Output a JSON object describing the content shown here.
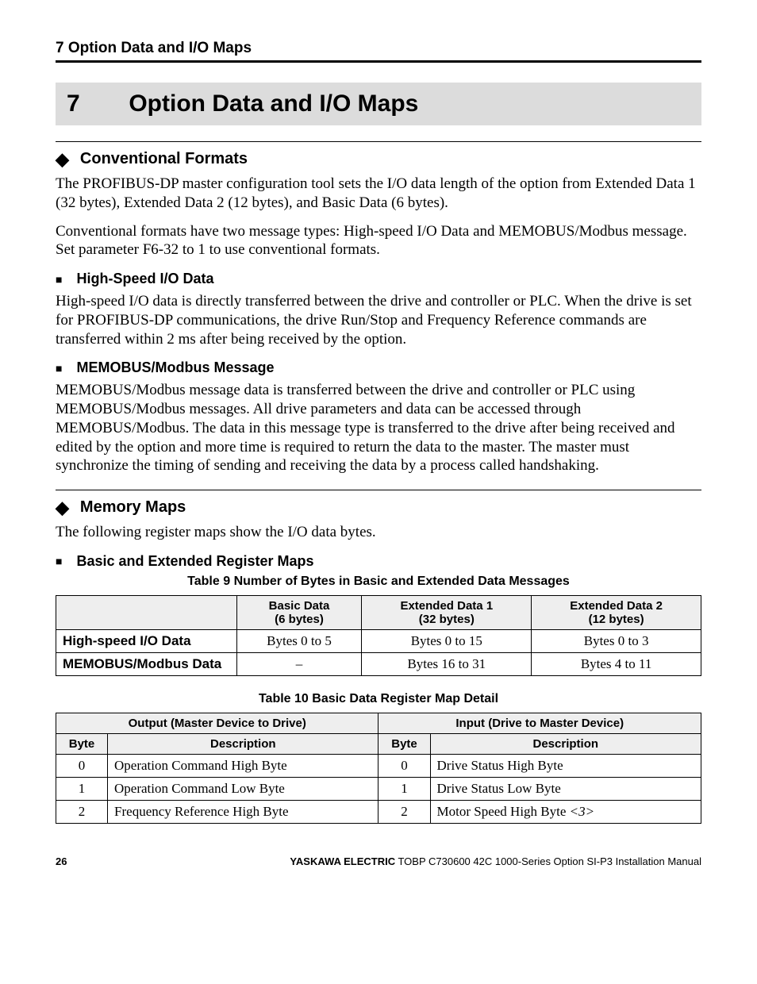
{
  "running_header": "7  Option Data and I/O Maps",
  "chapter": {
    "num": "7",
    "title": "Option Data and I/O Maps"
  },
  "sec1": {
    "title": "Conventional Formats",
    "p1": "The PROFIBUS-DP master configuration tool sets the I/O data length of the option from Extended Data 1 (32 bytes), Extended Data 2 (12 bytes), and Basic Data (6 bytes).",
    "p2": "Conventional formats have two message types: High-speed I/O Data and MEMOBUS/Modbus message. Set parameter F6-32 to 1 to use conventional formats.",
    "sub1": {
      "title": "High-Speed I/O Data",
      "p": "High-speed I/O data is directly transferred between the drive and controller or PLC. When the drive is set for PROFIBUS-DP communications, the drive Run/Stop and Frequency Reference commands are transferred within 2 ms after being received by the option."
    },
    "sub2": {
      "title": "MEMOBUS/Modbus Message",
      "p": "MEMOBUS/Modbus message data is transferred between the drive and controller or PLC using MEMOBUS/Modbus messages. All drive parameters and data can be accessed through MEMOBUS/Modbus. The data in this message type is transferred to the drive after being received and edited by the option and more time is required to return the data to the master. The master must synchronize the timing of sending and receiving the data by a process called handshaking."
    }
  },
  "sec2": {
    "title": "Memory Maps",
    "p1": "The following register maps show the I/O data bytes.",
    "sub1": {
      "title": "Basic and Extended Register Maps"
    }
  },
  "table9": {
    "caption": "Table 9  Number of Bytes in Basic and Extended Data Messages",
    "headers": {
      "blank": "",
      "c1a": "Basic Data",
      "c1b": "(6 bytes)",
      "c2a": "Extended Data 1",
      "c2b": "(32 bytes)",
      "c3a": "Extended Data 2",
      "c3b": "(12 bytes)"
    },
    "rows": [
      {
        "label": "High-speed I/O Data",
        "c1": "Bytes 0 to 5",
        "c2": "Bytes 0 to 15",
        "c3": "Bytes 0 to 3"
      },
      {
        "label": "MEMOBUS/Modbus Data",
        "c1": "–",
        "c2": "Bytes 16 to 31",
        "c3": "Bytes 4 to 11"
      }
    ]
  },
  "table10": {
    "caption": "Table 10  Basic Data Register Map Detail",
    "group_headers": {
      "out": "Output (Master Device to Drive)",
      "in": "Input (Drive to Master Device)"
    },
    "col_headers": {
      "byte": "Byte",
      "desc": "Description"
    },
    "rows": [
      {
        "ob": "0",
        "od": "Operation Command High Byte",
        "ib": "0",
        "id": "Drive Status High Byte"
      },
      {
        "ob": "1",
        "od": "Operation Command Low Byte",
        "ib": "1",
        "id": "Drive Status Low Byte"
      },
      {
        "ob": "2",
        "od": "Frequency Reference High Byte",
        "ib": "2",
        "id": "Motor Speed High Byte ",
        "note": "<3>"
      }
    ]
  },
  "footer": {
    "page": "26",
    "brand": "YASKAWA ELECTRIC",
    "doc": " TOBP C730600 42C 1000-Series Option SI-P3 Installation Manual"
  }
}
